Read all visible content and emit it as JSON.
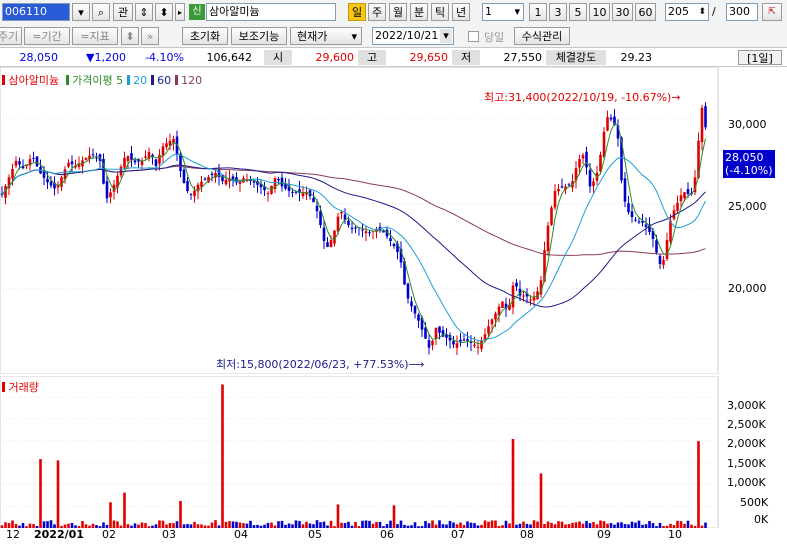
{
  "toolbar": {
    "code": "006110",
    "search_icon_glyph": "⌕",
    "item1": "관",
    "stock_tag": "신",
    "stock_name": "삼아알미늄",
    "periods": [
      "일",
      "주",
      "월",
      "분",
      "틱",
      "년"
    ],
    "period_active": 0,
    "interval": "1",
    "quick_counts": [
      "1",
      "3",
      "5",
      "10",
      "30",
      "60"
    ],
    "bar_count": "205",
    "separator": "/",
    "max_count": "300"
  },
  "toolbar2": {
    "btn_period": "주기",
    "btn_range": "=기간",
    "btn_indicator": "=지표",
    "btn_reset": "초기화",
    "btn_assist": "보조기능",
    "btn_price_type": "현재가",
    "date": "2022/10/21",
    "today_label": "당일",
    "formula_label": "수식관리"
  },
  "quote": {
    "price": "28,050",
    "change": "▼1,200",
    "rate": "-4.10%",
    "volume": "106,642",
    "open_label": "시",
    "open": "29,600",
    "high_label": "고",
    "high": "29,650",
    "low_label": "저",
    "low": "27,550",
    "strength_label": "체결강도",
    "strength": "29.23",
    "interval_badge": "[1일]"
  },
  "colors": {
    "up": "#e00000",
    "down": "#0000cc",
    "ma5": "#2e8b2e",
    "ma20": "#1a9fd8",
    "ma60": "#1c1c8c",
    "ma120": "#8b3a5a",
    "price_badge": "#0000cc"
  },
  "chart_data": [
    {
      "type": "candlestick",
      "legend": {
        "name": "삼아알미늄",
        "ma_label": "가격이평",
        "ma_periods": [
          "5",
          "20",
          "60",
          "120"
        ]
      },
      "x_ticks": [
        "12",
        "2022/01",
        "02",
        "03",
        "04",
        "05",
        "06",
        "07",
        "08",
        "09",
        "10"
      ],
      "y_ticks": [
        20000,
        25000,
        30000
      ],
      "y_tick_labels": [
        "20,000",
        "25,000",
        "30,000"
      ],
      "ylim": [
        15000,
        33000
      ],
      "current_price": "28,050",
      "current_rate": "(-4.10%)",
      "max_annotation": "최고:31,400(2022/10/19, -10.67%)→",
      "min_annotation": "최저:15,800(2022/06/23, +77.53%)⟶",
      "close_series": [
        [
          0,
          25200
        ],
        [
          8,
          26400
        ],
        [
          16,
          27500
        ],
        [
          24,
          27000
        ],
        [
          32,
          27800
        ],
        [
          40,
          26800
        ],
        [
          48,
          26200
        ],
        [
          56,
          25800
        ],
        [
          62,
          26600
        ],
        [
          68,
          27400
        ],
        [
          76,
          27200
        ],
        [
          84,
          27600
        ],
        [
          92,
          27900
        ],
        [
          100,
          27500
        ],
        [
          106,
          25200
        ],
        [
          112,
          25800
        ],
        [
          120,
          27000
        ],
        [
          126,
          27900
        ],
        [
          134,
          27400
        ],
        [
          142,
          27500
        ],
        [
          150,
          28100
        ],
        [
          156,
          27200
        ],
        [
          162,
          28300
        ],
        [
          168,
          28600
        ],
        [
          174,
          28800
        ],
        [
          180,
          27000
        ],
        [
          186,
          25800
        ],
        [
          192,
          25500
        ],
        [
          198,
          26100
        ],
        [
          204,
          26400
        ],
        [
          210,
          26600
        ],
        [
          216,
          26800
        ],
        [
          222,
          26300
        ],
        [
          230,
          26500
        ],
        [
          236,
          26200
        ],
        [
          244,
          26500
        ],
        [
          252,
          26300
        ],
        [
          260,
          26000
        ],
        [
          268,
          25600
        ],
        [
          276,
          26600
        ],
        [
          282,
          26000
        ],
        [
          290,
          25700
        ],
        [
          298,
          25600
        ],
        [
          306,
          25700
        ],
        [
          312,
          25300
        ],
        [
          318,
          24400
        ],
        [
          324,
          22800
        ],
        [
          328,
          22400
        ],
        [
          334,
          23300
        ],
        [
          340,
          24700
        ],
        [
          346,
          23900
        ],
        [
          352,
          23500
        ],
        [
          358,
          23600
        ],
        [
          364,
          23400
        ],
        [
          370,
          23300
        ],
        [
          376,
          23500
        ],
        [
          382,
          23400
        ],
        [
          388,
          23000
        ],
        [
          394,
          22500
        ],
        [
          400,
          21900
        ],
        [
          406,
          19700
        ],
        [
          412,
          18900
        ],
        [
          418,
          18200
        ],
        [
          424,
          17300
        ],
        [
          430,
          16400
        ],
        [
          436,
          17700
        ],
        [
          442,
          17200
        ],
        [
          448,
          17100
        ],
        [
          454,
          16700
        ],
        [
          460,
          16900
        ],
        [
          466,
          17000
        ],
        [
          472,
          16800
        ],
        [
          478,
          16600
        ],
        [
          484,
          17200
        ],
        [
          490,
          18000
        ],
        [
          496,
          18600
        ],
        [
          502,
          19300
        ],
        [
          508,
          18600
        ],
        [
          514,
          20500
        ],
        [
          520,
          19600
        ],
        [
          526,
          19600
        ],
        [
          532,
          19300
        ],
        [
          538,
          19900
        ],
        [
          542,
          20700
        ],
        [
          546,
          23200
        ],
        [
          550,
          24200
        ],
        [
          554,
          25700
        ],
        [
          560,
          25900
        ],
        [
          566,
          26000
        ],
        [
          572,
          26200
        ],
        [
          578,
          27500
        ],
        [
          584,
          27900
        ],
        [
          590,
          26000
        ],
        [
          596,
          26500
        ],
        [
          602,
          28300
        ],
        [
          606,
          30100
        ],
        [
          610,
          30000
        ],
        [
          614,
          29700
        ],
        [
          618,
          28800
        ],
        [
          622,
          26000
        ],
        [
          626,
          24800
        ],
        [
          630,
          24300
        ],
        [
          636,
          24000
        ],
        [
          642,
          23900
        ],
        [
          648,
          23500
        ],
        [
          654,
          22800
        ],
        [
          658,
          21700
        ],
        [
          662,
          21200
        ],
        [
          666,
          22500
        ],
        [
          670,
          23900
        ],
        [
          674,
          24600
        ],
        [
          678,
          25100
        ],
        [
          682,
          25600
        ],
        [
          686,
          25700
        ],
        [
          690,
          25400
        ],
        [
          694,
          25900
        ],
        [
          698,
          28400
        ],
        [
          702,
          30600
        ],
        [
          706,
          29300
        ],
        [
          708,
          28050
        ]
      ]
    },
    {
      "type": "bar",
      "name": "거래량",
      "y_ticks": [
        0,
        500,
        1000,
        1500,
        2000,
        2500,
        3000
      ],
      "y_tick_labels": [
        "0K",
        "500K",
        "1,000K",
        "1,500K",
        "2,000K",
        "2,500K",
        "3,000K"
      ],
      "ylim": [
        0,
        3300
      ],
      "unit": "K",
      "spikes": [
        {
          "x": 42,
          "value": 1580
        },
        {
          "x": 58,
          "value": 1550
        },
        {
          "x": 110,
          "value": 590
        },
        {
          "x": 124,
          "value": 810
        },
        {
          "x": 182,
          "value": 620
        },
        {
          "x": 221,
          "value": 3290
        },
        {
          "x": 338,
          "value": 540
        },
        {
          "x": 394,
          "value": 520
        },
        {
          "x": 514,
          "value": 2040
        },
        {
          "x": 540,
          "value": 1250
        },
        {
          "x": 700,
          "value": 1990
        }
      ]
    }
  ]
}
